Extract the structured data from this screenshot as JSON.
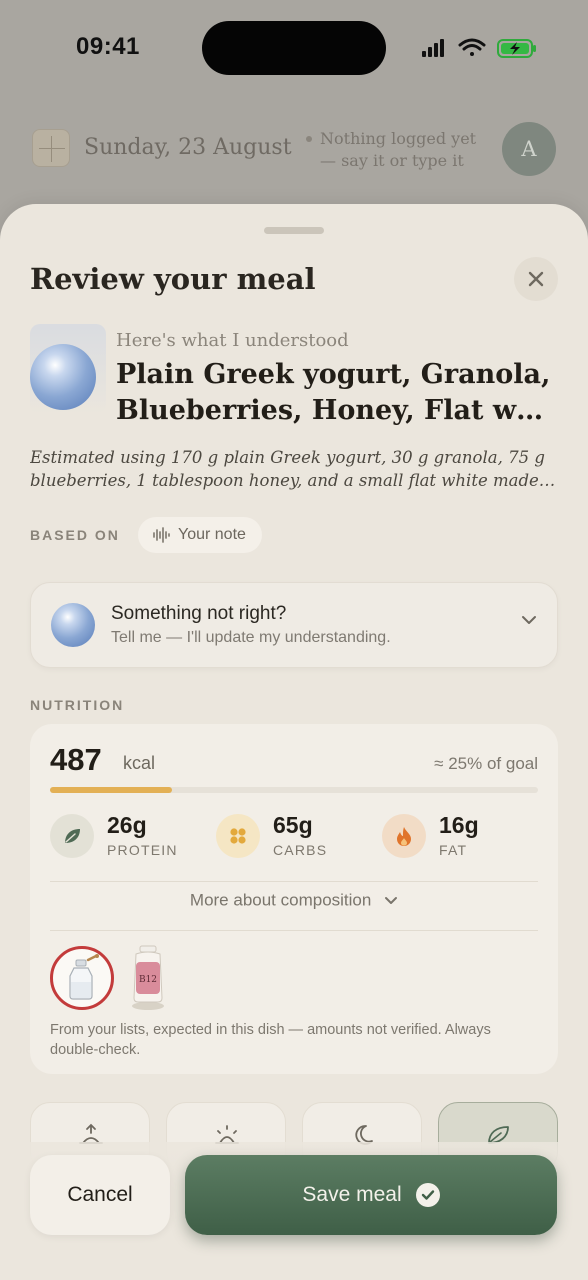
{
  "status_bar": {
    "time": "09:41"
  },
  "background": {
    "date": "Sunday, 23 August",
    "hint_line1": "Nothing logged yet",
    "hint_line2": "— say it or type it",
    "avatar_initial": "A"
  },
  "sheet": {
    "title": "Review your meal",
    "understood_label": "Here's what I understood",
    "meal_name_line1": "Plain Greek yogurt, Granola,",
    "meal_name_line2": "Blueberries, Honey, Flat white",
    "estimate_line1": "Estimated using 170 g plain Greek yogurt, 30 g granola, 75 g",
    "estimate_line2": "blueberries, 1 tablespoon honey, and a small flat white made with milk",
    "based_on_label": "BASED ON",
    "based_on_chip": "Your note"
  },
  "feedback": {
    "title": "Something not right?",
    "subtitle": "Tell me — I'll update my understanding."
  },
  "nutrition": {
    "section_label": "NUTRITION",
    "kcal": "487",
    "kcal_unit": "kcal",
    "goal_text": "≈ 25% of goal",
    "goal_fraction": 0.25,
    "macros": [
      {
        "value": "26g",
        "label": "PROTEIN",
        "icon": "leaf-icon"
      },
      {
        "value": "65g",
        "label": "CARBS",
        "icon": "grain-icon"
      },
      {
        "value": "16g",
        "label": "FAT",
        "icon": "flame-icon"
      }
    ],
    "more_composition": "More about composition",
    "b12_label": "B12",
    "lists_note": "From your lists, expected in this dish — amounts not verified. Always double-check."
  },
  "meal_types": [
    {
      "icon": "sunrise-icon"
    },
    {
      "icon": "sun-icon"
    },
    {
      "icon": "moon-icon"
    },
    {
      "icon": "leaf-icon",
      "selected": true
    }
  ],
  "actions": {
    "cancel": "Cancel",
    "save": "Save meal"
  },
  "colors": {
    "accent_green": "#4a6b52",
    "progress": "#e3b055",
    "highlight_red": "#c33b3b"
  }
}
